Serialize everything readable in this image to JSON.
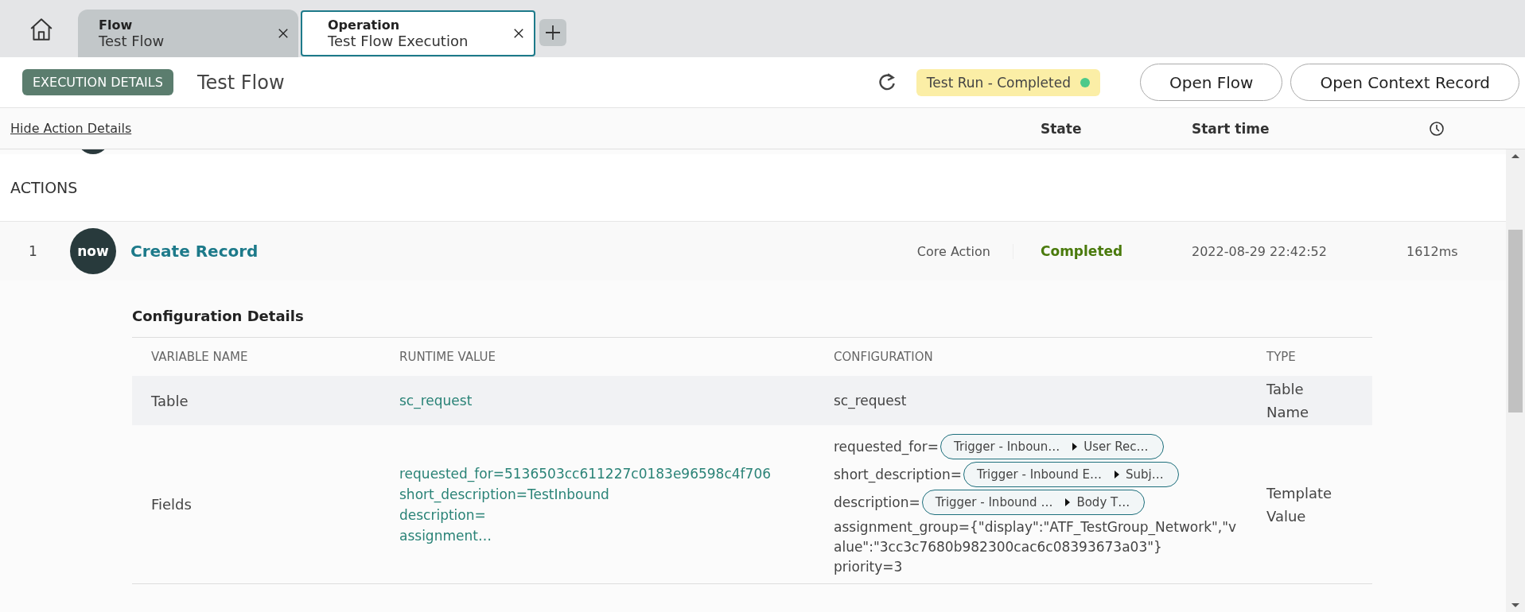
{
  "tabs": [
    {
      "title": "Flow",
      "subtitle": "Test Flow",
      "selected": false
    },
    {
      "title": "Operation",
      "subtitle": "Test Flow Execution",
      "selected": true
    }
  ],
  "header": {
    "badge": "EXECUTION DETAILS",
    "title": "Test Flow",
    "status": {
      "label": "Test Run - Completed",
      "color": "#4cc98a"
    },
    "buttons": [
      "Open Flow",
      "Open Context Record"
    ]
  },
  "toolbar": {
    "link": "Hide Action Details",
    "columns": [
      "State",
      "Start time"
    ]
  },
  "section": "ACTIONS",
  "actions": [
    {
      "number": "1",
      "logo": "now",
      "name": "Create Record",
      "type": "Core Action",
      "state": "Completed",
      "start_time": "2022-08-29 22:42:52",
      "duration": "1612ms",
      "config": {
        "title": "Configuration Details",
        "columns": [
          "VARIABLE NAME",
          "RUNTIME VALUE",
          "CONFIGURATION",
          "TYPE"
        ],
        "rows": [
          {
            "name": "Table",
            "runtime": [
              "sc_request"
            ],
            "configuration": [
              {
                "kind": "text",
                "text": "sc_request"
              }
            ],
            "type": "Table Name"
          },
          {
            "name": "Fields",
            "runtime": [
              "requested_for=5136503cc611227c0183e96598c4f706",
              "short_description=TestInbound",
              "description=",
              "assignment…"
            ],
            "configuration": [
              {
                "kind": "pill",
                "label": "requested_for=",
                "source": "Trigger - Inboun…",
                "field": "User Rec…"
              },
              {
                "kind": "pill",
                "label": "short_description=",
                "source": "Trigger - Inbound E…",
                "field": "Subj…"
              },
              {
                "kind": "pill",
                "label": "description=",
                "source": "Trigger - Inbound …",
                "field": "Body T…"
              },
              {
                "kind": "text",
                "text": "assignment_group={\"display\":\"ATF_TestGroup_Network\",\"value\":\"3cc3c7680b982300cac6c08393673a03\"}"
              },
              {
                "kind": "text",
                "text": "priority=3"
              }
            ],
            "type": "Template Value"
          }
        ]
      }
    }
  ]
}
